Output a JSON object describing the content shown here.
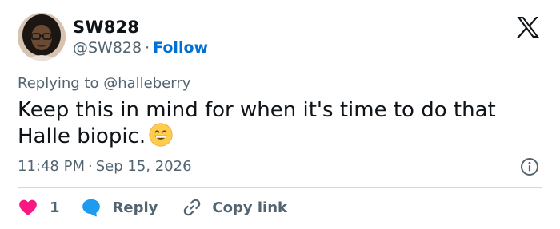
{
  "author": {
    "display_name": "SW828",
    "handle": "@SW828",
    "separator": "·",
    "follow_label": "Follow"
  },
  "reply_context": {
    "prefix": "Replying to",
    "target": "@halleberry"
  },
  "tweet": {
    "text": "Keep this in mind for when it's time to do that Halle biopic.",
    "emoji": "grinning-face-with-smiling-eyes-emoji",
    "time": "11:48 PM",
    "separator": "·",
    "date": "Sep 15, 2026"
  },
  "actions": {
    "like_count": "1",
    "reply_label": "Reply",
    "copy_link_label": "Copy link"
  },
  "icons": {
    "brand": "x-logo-icon",
    "info": "info-icon",
    "like": "heart-icon",
    "reply": "speech-bubble-icon",
    "copy": "link-icon"
  },
  "colors": {
    "text_primary": "#0f1419",
    "text_secondary": "#536471",
    "follow": "#006fd6",
    "heart": "#f91880",
    "reply_bubble": "#1d9bf0",
    "divider": "#cfd9de"
  }
}
